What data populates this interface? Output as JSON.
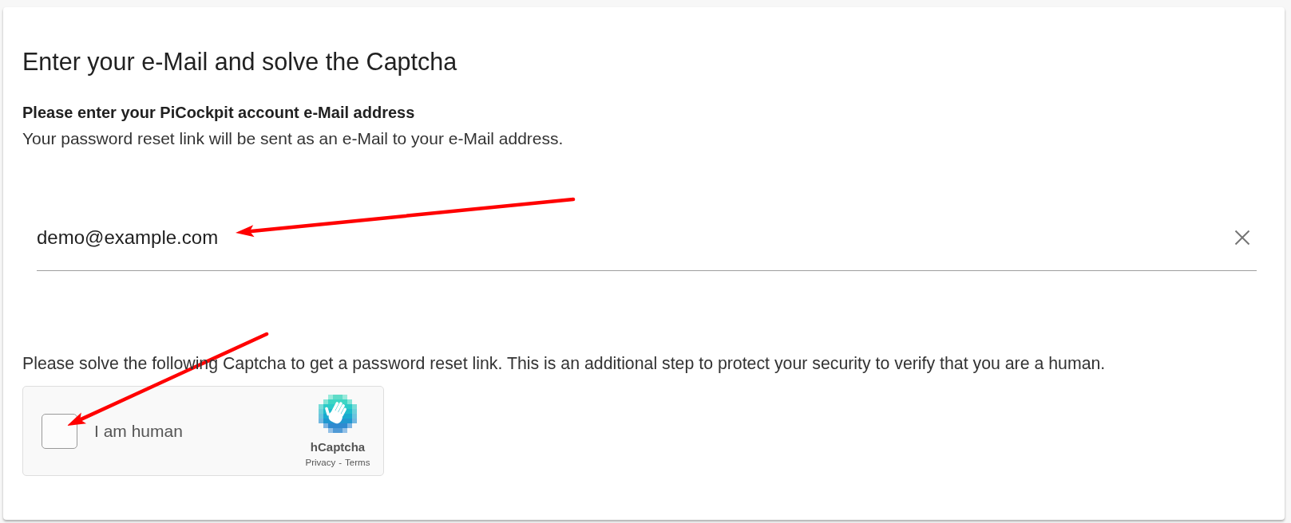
{
  "card": {
    "title": "Enter your e-Mail and solve the Captcha",
    "email_section": {
      "heading": "Please enter your PiCockpit account e-Mail address",
      "description": "Your password reset link will be sent as an e-Mail to your e-Mail address.",
      "email_field": {
        "value": "demo@example.com",
        "clear_button": true
      }
    },
    "captcha_section": {
      "instructions": "Please solve the following Captcha to get a password reset link. This is an additional step to protect your security to verify that you are a human.",
      "captcha": {
        "checkbox_label": "I am human",
        "checked": false,
        "brand": "hCaptcha",
        "links": [
          "Privacy",
          "Terms"
        ],
        "link_separator": "-"
      }
    }
  },
  "annotations": [
    {
      "kind": "arrow"
    },
    {
      "kind": "arrow"
    }
  ]
}
